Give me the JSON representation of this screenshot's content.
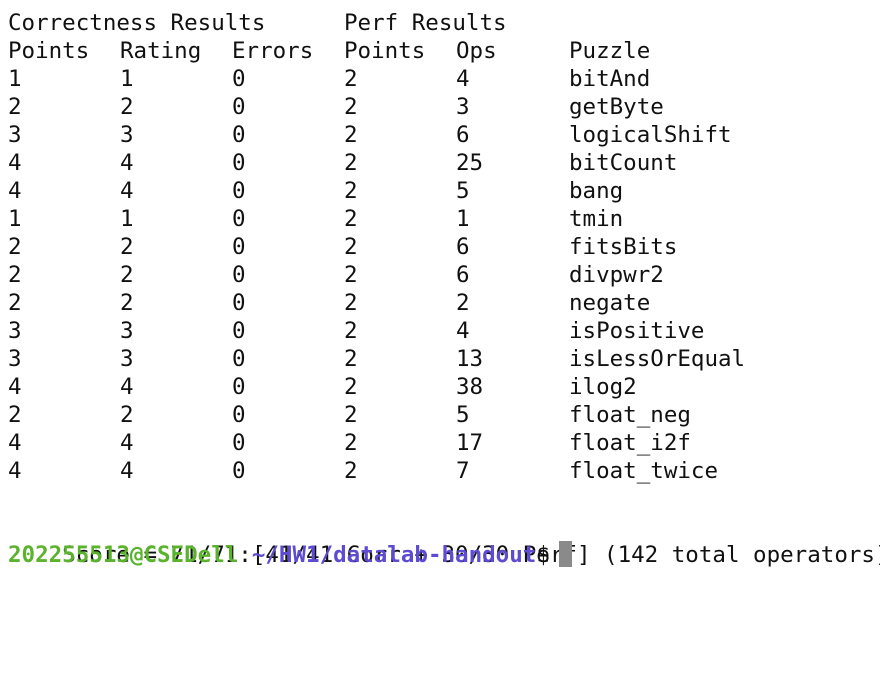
{
  "terminal": {
    "header1": {
      "correctness": "Correctness Results",
      "perf": "Perf Results"
    },
    "header2": {
      "points": "Points",
      "rating": "Rating",
      "errors": "Errors",
      "perf_points": "Points",
      "ops": "Ops",
      "puzzle": "Puzzle"
    },
    "rows": [
      {
        "points": "1",
        "rating": "1",
        "errors": "0",
        "perf_points": "2",
        "ops": "4",
        "puzzle": "bitAnd"
      },
      {
        "points": "2",
        "rating": "2",
        "errors": "0",
        "perf_points": "2",
        "ops": "3",
        "puzzle": "getByte"
      },
      {
        "points": "3",
        "rating": "3",
        "errors": "0",
        "perf_points": "2",
        "ops": "6",
        "puzzle": "logicalShift"
      },
      {
        "points": "4",
        "rating": "4",
        "errors": "0",
        "perf_points": "2",
        "ops": "25",
        "puzzle": "bitCount"
      },
      {
        "points": "4",
        "rating": "4",
        "errors": "0",
        "perf_points": "2",
        "ops": "5",
        "puzzle": "bang"
      },
      {
        "points": "1",
        "rating": "1",
        "errors": "0",
        "perf_points": "2",
        "ops": "1",
        "puzzle": "tmin"
      },
      {
        "points": "2",
        "rating": "2",
        "errors": "0",
        "perf_points": "2",
        "ops": "6",
        "puzzle": "fitsBits"
      },
      {
        "points": "2",
        "rating": "2",
        "errors": "0",
        "perf_points": "2",
        "ops": "6",
        "puzzle": "divpwr2"
      },
      {
        "points": "2",
        "rating": "2",
        "errors": "0",
        "perf_points": "2",
        "ops": "2",
        "puzzle": "negate"
      },
      {
        "points": "3",
        "rating": "3",
        "errors": "0",
        "perf_points": "2",
        "ops": "4",
        "puzzle": "isPositive"
      },
      {
        "points": "3",
        "rating": "3",
        "errors": "0",
        "perf_points": "2",
        "ops": "13",
        "puzzle": "isLessOrEqual"
      },
      {
        "points": "4",
        "rating": "4",
        "errors": "0",
        "perf_points": "2",
        "ops": "38",
        "puzzle": "ilog2"
      },
      {
        "points": "2",
        "rating": "2",
        "errors": "0",
        "perf_points": "2",
        "ops": "5",
        "puzzle": "float_neg"
      },
      {
        "points": "4",
        "rating": "4",
        "errors": "0",
        "perf_points": "2",
        "ops": "17",
        "puzzle": "float_i2f"
      },
      {
        "points": "4",
        "rating": "4",
        "errors": "0",
        "perf_points": "2",
        "ops": "7",
        "puzzle": "float_twice"
      }
    ],
    "score_line": "Score = 71/71 [41/41 Corr + 30/30 Perf] (142 total operators)",
    "prompt": {
      "user_host": "202255513@CSEDell",
      "separator": ":",
      "path": "~/HW1/datalab-handout",
      "symbol": "$"
    }
  },
  "colors": {
    "background": "#ffffff",
    "text": "#111111",
    "user_host": "#5bb32d",
    "path": "#5d4bd2",
    "cursor": "#8a8a8a"
  }
}
